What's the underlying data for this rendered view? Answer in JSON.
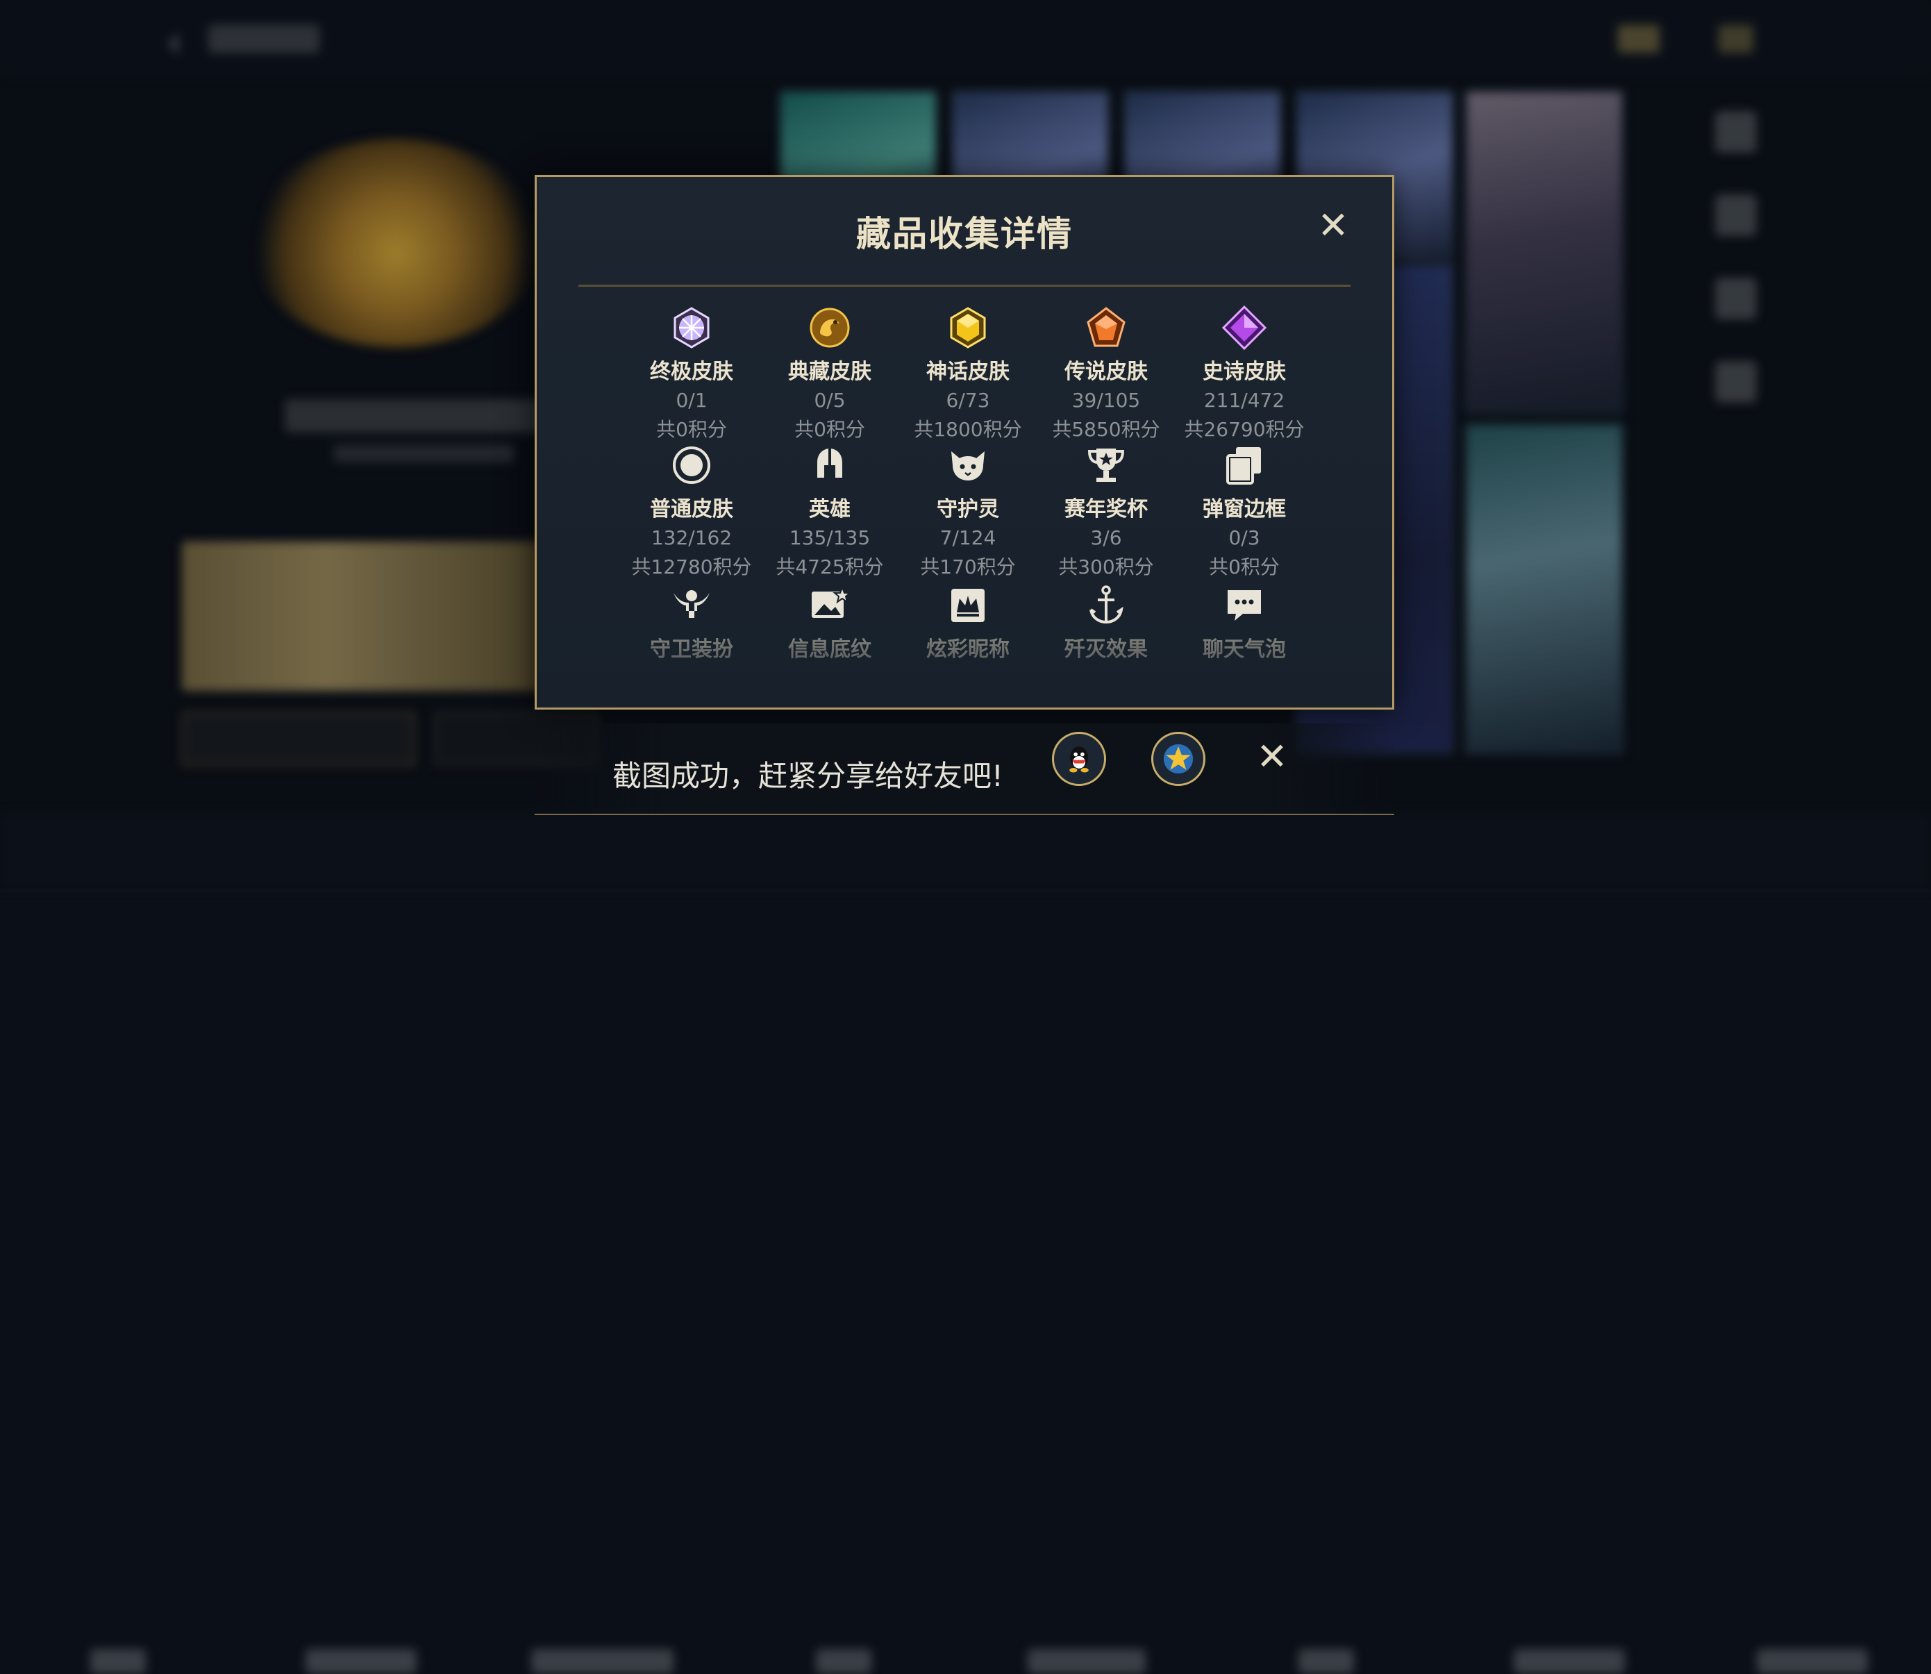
{
  "modal": {
    "title": "藏品收集详情",
    "items": [
      {
        "label": "终极皮肤",
        "count": "0/1",
        "points": "共0积分",
        "icon": "ultimate-skin-icon",
        "color": "#c9b4ff"
      },
      {
        "label": "典藏皮肤",
        "count": "0/5",
        "points": "共0积分",
        "icon": "collector-skin-icon",
        "color": "#e2a81f"
      },
      {
        "label": "神话皮肤",
        "count": "6/73",
        "points": "共1800积分",
        "icon": "mythic-skin-icon",
        "color": "#f3c51b"
      },
      {
        "label": "传说皮肤",
        "count": "39/105",
        "points": "共5850积分",
        "icon": "legendary-skin-icon",
        "color": "#f07a2a"
      },
      {
        "label": "史诗皮肤",
        "count": "211/472",
        "points": "共26790积分",
        "icon": "epic-skin-icon",
        "color": "#b44be8"
      },
      {
        "label": "普通皮肤",
        "count": "132/162",
        "points": "共12780积分",
        "icon": "common-skin-icon",
        "color": "#e8e4d8"
      },
      {
        "label": "英雄",
        "count": "135/135",
        "points": "共4725积分",
        "icon": "hero-helmet-icon",
        "color": "#e8e4d8"
      },
      {
        "label": "守护灵",
        "count": "7/124",
        "points": "共170积分",
        "icon": "guardian-spirit-icon",
        "color": "#e8e4d8"
      },
      {
        "label": "赛年奖杯",
        "count": "3/6",
        "points": "共300积分",
        "icon": "trophy-icon",
        "color": "#e8e4d8"
      },
      {
        "label": "弹窗边框",
        "count": "0/3",
        "points": "共0积分",
        "icon": "popup-frame-icon",
        "color": "#e8e4d8"
      },
      {
        "label": "守卫装扮",
        "icon": "guard-outfit-icon",
        "color": "#e8e4d8"
      },
      {
        "label": "信息底纹",
        "icon": "info-background-icon",
        "color": "#e8e4d8"
      },
      {
        "label": "炫彩昵称",
        "icon": "colorful-nickname-icon",
        "color": "#e8e4d8"
      },
      {
        "label": "歼灭效果",
        "icon": "kill-effect-icon",
        "color": "#e8e4d8"
      },
      {
        "label": "聊天气泡",
        "icon": "chat-bubble-icon",
        "color": "#e8e4d8"
      }
    ]
  },
  "toast": {
    "message": "截图成功，赶紧分享给好友吧!",
    "share_icons": [
      "qq-icon",
      "favorite-star-icon"
    ]
  },
  "colors": {
    "accent_gold": "#b49a63",
    "modal_bg": "#1c2530",
    "title_text": "#ece2c6",
    "muted_text": "#8e9296"
  }
}
